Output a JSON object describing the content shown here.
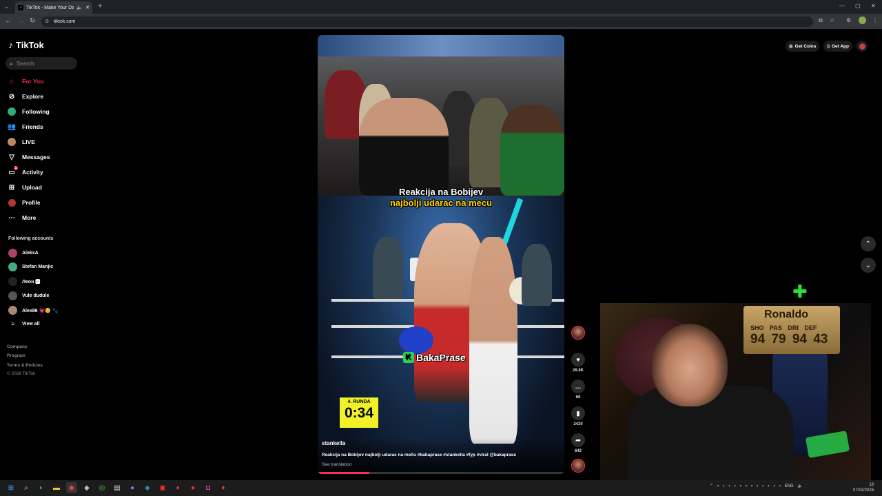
{
  "browser": {
    "tab_title": "TikTok - Make Your Day",
    "url": "tiktok.com"
  },
  "sidebar": {
    "logo": "TikTok",
    "search_placeholder": "Search",
    "nav": [
      {
        "label": "For You",
        "icon": "home-icon",
        "active": true
      },
      {
        "label": "Explore",
        "icon": "compass-icon"
      },
      {
        "label": "Following",
        "icon": "following-icon"
      },
      {
        "label": "Friends",
        "icon": "friends-icon"
      },
      {
        "label": "LIVE",
        "icon": "live-icon"
      },
      {
        "label": "Messages",
        "icon": "messages-icon"
      },
      {
        "label": "Activity",
        "icon": "activity-icon",
        "badge": "1"
      },
      {
        "label": "Upload",
        "icon": "upload-icon"
      },
      {
        "label": "Profile",
        "icon": "profile-icon"
      },
      {
        "label": "More",
        "icon": "more-icon"
      }
    ],
    "following_header": "Following accounts",
    "following": [
      {
        "name": "AleksA"
      },
      {
        "name": "Stefan Manjic"
      },
      {
        "name": "Леон 🅷"
      },
      {
        "name": "Vule dudule"
      },
      {
        "name": "Alex86 💗😊 🐾"
      }
    ],
    "view_all": "View all",
    "footer": [
      "Company",
      "Program",
      "Terms & Policies",
      "© 2026 TikTok"
    ]
  },
  "topbar": {
    "get_coins": "Get Coins",
    "get_app": "Get App"
  },
  "video": {
    "caption_line1": "Reakcija na Bobijev",
    "caption_line2": "najbolji udarac na mecu",
    "watermark": "BakaPrase",
    "round_label": "4. RUNDA",
    "round_time": "0:34",
    "author": "stankella",
    "description": "Reakcija na Bobijev najbolji udarac na meču #bakaprase #stankella #fyp #viral @bakaprase",
    "see_translation": "See translation",
    "progress": 0.21
  },
  "actions": {
    "likes": "28.8K",
    "comments": "68",
    "saves": "2420",
    "shares": "642"
  },
  "webcam": {
    "card_name": "Ronaldo",
    "card_labels": "SHO PAS DRI DEF",
    "card_values": "94 79 94 43"
  },
  "taskbar": {
    "lang": "ENG",
    "time": "19",
    "date": "07/02/2026"
  }
}
